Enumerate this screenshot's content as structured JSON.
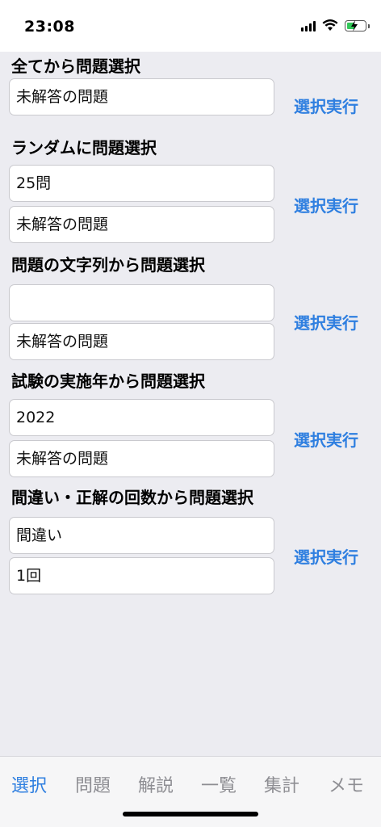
{
  "status": {
    "time": "23:08"
  },
  "sections": [
    {
      "title": "全てから問題選択",
      "fields": [
        "未解答の問題"
      ],
      "button": "選択実行"
    },
    {
      "title": "ランダムに問題選択",
      "fields": [
        "25問",
        "未解答の問題"
      ],
      "button": "選択実行"
    },
    {
      "title": "問題の文字列から問題選択",
      "fields": [
        "",
        "未解答の問題"
      ],
      "button": "選択実行"
    },
    {
      "title": "試験の実施年から問題選択",
      "fields": [
        "2022",
        "未解答の問題"
      ],
      "button": "選択実行"
    },
    {
      "title": "間違い・正解の回数から問題選択",
      "fields": [
        "間違い",
        "1回"
      ],
      "button": "選択実行"
    }
  ],
  "tabs": [
    {
      "label": "選択",
      "active": true
    },
    {
      "label": "問題",
      "active": false
    },
    {
      "label": "解説",
      "active": false
    },
    {
      "label": "一覧",
      "active": false
    },
    {
      "label": "集計",
      "active": false
    },
    {
      "label": "メモ",
      "active": false
    }
  ],
  "colors": {
    "accent": "#2f7fe0",
    "background": "#ececf1",
    "battery": "#33c759"
  },
  "icons": [
    "cellular-signal-icon",
    "wifi-icon",
    "battery-charging-icon"
  ]
}
